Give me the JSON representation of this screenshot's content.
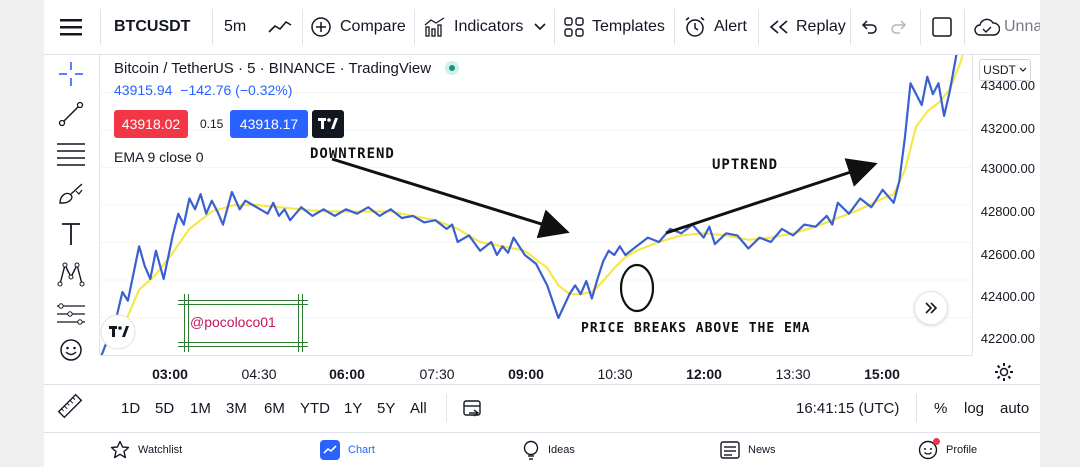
{
  "toolbar": {
    "symbol": "BTCUSDT",
    "interval": "5m",
    "compare_label": "Compare",
    "indicators_label": "Indicators",
    "templates_label": "Templates",
    "alert_label": "Alert",
    "replay_label": "Replay",
    "unnamed_label": "Unna"
  },
  "legend": {
    "title": "Bitcoin / TetherUS · 5 · BINANCE · TradingView",
    "price": "43915.94",
    "change": "−142.76 (−0.32%)",
    "sell_price": "43918.02",
    "spread": "0.15",
    "buy_price": "43918.17",
    "ema_label": "EMA 9 close 0"
  },
  "annotations": {
    "downtrend": "DOWNTREND",
    "uptrend": "UPTREND",
    "breakout": "PRICE BREAKS ABOVE THE EMA",
    "watermark": "@pocoloco01"
  },
  "price_scale": {
    "currency": "USDT",
    "labels": [
      "43400.00",
      "43200.00",
      "43000.00",
      "42800.00",
      "42600.00",
      "42400.00",
      "42200.00"
    ]
  },
  "time_axis": [
    {
      "label": "03:00",
      "bold": true
    },
    {
      "label": "04:30",
      "bold": false
    },
    {
      "label": "06:00",
      "bold": true
    },
    {
      "label": "07:30",
      "bold": false
    },
    {
      "label": "09:00",
      "bold": true
    },
    {
      "label": "10:30",
      "bold": false
    },
    {
      "label": "12:00",
      "bold": true
    },
    {
      "label": "13:30",
      "bold": false
    },
    {
      "label": "15:00",
      "bold": true
    }
  ],
  "ranges": [
    "1D",
    "5D",
    "1M",
    "3M",
    "6M",
    "YTD",
    "1Y",
    "5Y",
    "All"
  ],
  "clock": "16:41:15 (UTC)",
  "scale_options": {
    "percent": "%",
    "log": "log",
    "auto": "auto"
  },
  "bottom_nav": [
    {
      "label": "Watchlist",
      "icon": "star-icon",
      "active": false
    },
    {
      "label": "Chart",
      "icon": "chart-icon",
      "active": true
    },
    {
      "label": "Ideas",
      "icon": "lightbulb-icon",
      "active": false
    },
    {
      "label": "News",
      "icon": "news-icon",
      "active": false
    },
    {
      "label": "Profile",
      "icon": "profile-icon",
      "active": false
    }
  ],
  "colors": {
    "price_line": "#3a5fd0",
    "ema_line": "#f5e84a",
    "sell": "#f23645",
    "buy": "#2962ff",
    "change": "#2962ff",
    "live_dot": "#089981",
    "watermark_text": "#c2185b"
  },
  "chart_data": {
    "type": "line",
    "y_range": [
      42100,
      43480
    ],
    "series": [
      {
        "name": "price",
        "points": [
          [
            0.0,
            42080
          ],
          [
            1.5,
            42280
          ],
          [
            2.0,
            42390
          ],
          [
            2.5,
            42350
          ],
          [
            3.5,
            42600
          ],
          [
            4.0,
            42510
          ],
          [
            4.5,
            42450
          ],
          [
            5.0,
            42580
          ],
          [
            5.7,
            42450
          ],
          [
            6.5,
            42650
          ],
          [
            7.0,
            42750
          ],
          [
            7.5,
            42700
          ],
          [
            8.0,
            42820
          ],
          [
            8.5,
            42770
          ],
          [
            9.0,
            42840
          ],
          [
            9.5,
            42750
          ],
          [
            10.0,
            42810
          ],
          [
            10.5,
            42760
          ],
          [
            11.0,
            42700
          ],
          [
            11.8,
            42850
          ],
          [
            12.5,
            42770
          ],
          [
            13.0,
            42810
          ],
          [
            14.0,
            42780
          ],
          [
            15.0,
            42750
          ],
          [
            15.5,
            42800
          ],
          [
            16.0,
            42740
          ],
          [
            16.5,
            42770
          ],
          [
            17.0,
            42720
          ],
          [
            18.0,
            42780
          ],
          [
            19.0,
            42740
          ],
          [
            20.0,
            42770
          ],
          [
            21.0,
            42740
          ],
          [
            22.0,
            42770
          ],
          [
            23.0,
            42750
          ],
          [
            24.0,
            42780
          ],
          [
            25.0,
            42740
          ],
          [
            26.0,
            42770
          ],
          [
            27.0,
            42730
          ],
          [
            28.0,
            42740
          ],
          [
            29.0,
            42710
          ],
          [
            30.0,
            42720
          ],
          [
            31.0,
            42680
          ],
          [
            31.5,
            42700
          ],
          [
            32.0,
            42620
          ],
          [
            33.0,
            42650
          ],
          [
            34.0,
            42580
          ],
          [
            35.0,
            42620
          ],
          [
            35.5,
            42560
          ],
          [
            36.0,
            42600
          ],
          [
            36.5,
            42570
          ],
          [
            37.0,
            42640
          ],
          [
            38.0,
            42560
          ],
          [
            39.0,
            42520
          ],
          [
            40.0,
            42420
          ],
          [
            41.0,
            42270
          ],
          [
            42.0,
            42380
          ],
          [
            42.5,
            42420
          ],
          [
            43.0,
            42380
          ],
          [
            43.5,
            42440
          ],
          [
            44.0,
            42360
          ],
          [
            44.5,
            42450
          ],
          [
            45.0,
            42530
          ],
          [
            45.5,
            42580
          ],
          [
            46.0,
            42560
          ],
          [
            46.5,
            42600
          ],
          [
            47.0,
            42560
          ],
          [
            48.0,
            42600
          ],
          [
            49.0,
            42640
          ],
          [
            50.0,
            42620
          ],
          [
            51.0,
            42680
          ],
          [
            52.0,
            42660
          ],
          [
            53.0,
            42700
          ],
          [
            54.0,
            42640
          ],
          [
            54.5,
            42690
          ],
          [
            55.0,
            42610
          ],
          [
            56.0,
            42660
          ],
          [
            57.0,
            42650
          ],
          [
            58.0,
            42590
          ],
          [
            59.0,
            42640
          ],
          [
            60.0,
            42620
          ],
          [
            61.0,
            42680
          ],
          [
            62.0,
            42650
          ],
          [
            63.0,
            42700
          ],
          [
            64.0,
            42690
          ],
          [
            65.0,
            42740
          ],
          [
            65.5,
            42700
          ],
          [
            66.0,
            42800
          ],
          [
            67.0,
            42750
          ],
          [
            68.0,
            42820
          ],
          [
            69.0,
            42780
          ],
          [
            70.0,
            42860
          ],
          [
            71.0,
            42800
          ],
          [
            71.5,
            42900
          ],
          [
            72.0,
            43100
          ],
          [
            72.5,
            43350
          ],
          [
            73.0,
            43300
          ],
          [
            73.5,
            43250
          ],
          [
            74.0,
            43380
          ],
          [
            74.5,
            43300
          ],
          [
            75.0,
            43350
          ],
          [
            75.5,
            43200
          ],
          [
            76.0,
            43310
          ],
          [
            76.5,
            43450
          ],
          [
            77.0,
            43600
          ]
        ]
      },
      {
        "name": "EMA 9",
        "points": [
          [
            1.5,
            42180
          ],
          [
            2.5,
            42280
          ],
          [
            3.5,
            42400
          ],
          [
            5.0,
            42470
          ],
          [
            6.5,
            42570
          ],
          [
            8.0,
            42680
          ],
          [
            10.0,
            42760
          ],
          [
            12.0,
            42790
          ],
          [
            14.0,
            42790
          ],
          [
            16.0,
            42780
          ],
          [
            18.0,
            42770
          ],
          [
            20.0,
            42760
          ],
          [
            22.0,
            42760
          ],
          [
            24.0,
            42760
          ],
          [
            26.0,
            42760
          ],
          [
            28.0,
            42740
          ],
          [
            30.0,
            42720
          ],
          [
            32.0,
            42680
          ],
          [
            34.0,
            42620
          ],
          [
            36.0,
            42600
          ],
          [
            38.0,
            42580
          ],
          [
            40.0,
            42500
          ],
          [
            41.0,
            42420
          ],
          [
            42.0,
            42380
          ],
          [
            43.0,
            42380
          ],
          [
            44.0,
            42390
          ],
          [
            45.0,
            42440
          ],
          [
            46.0,
            42500
          ],
          [
            47.0,
            42550
          ],
          [
            48.0,
            42580
          ],
          [
            50.0,
            42620
          ],
          [
            52.0,
            42650
          ],
          [
            54.0,
            42660
          ],
          [
            56.0,
            42650
          ],
          [
            58.0,
            42630
          ],
          [
            60.0,
            42640
          ],
          [
            62.0,
            42660
          ],
          [
            64.0,
            42690
          ],
          [
            66.0,
            42730
          ],
          [
            68.0,
            42770
          ],
          [
            70.0,
            42820
          ],
          [
            71.0,
            42840
          ],
          [
            72.0,
            42950
          ],
          [
            73.0,
            43150
          ],
          [
            74.0,
            43220
          ],
          [
            75.0,
            43260
          ],
          [
            76.0,
            43320
          ],
          [
            77.0,
            43450
          ],
          [
            77.8,
            43600
          ]
        ]
      }
    ]
  }
}
